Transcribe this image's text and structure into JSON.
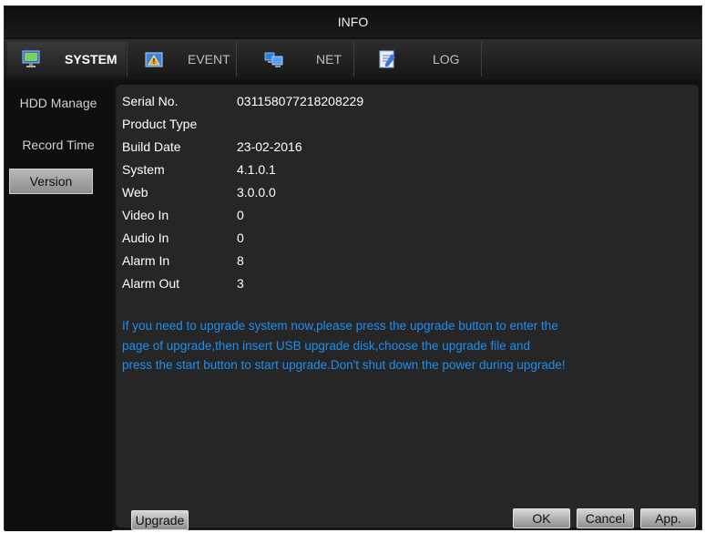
{
  "title": "INFO",
  "tabs": [
    {
      "label": "SYSTEM",
      "icon": "monitor-icon",
      "active": true
    },
    {
      "label": "EVENT",
      "icon": "warning-icon",
      "active": false
    },
    {
      "label": "NET",
      "icon": "network-icon",
      "active": false
    },
    {
      "label": "LOG",
      "icon": "notepad-icon",
      "active": false
    }
  ],
  "sidebar": {
    "items": [
      {
        "label": "HDD Manage",
        "active": false
      },
      {
        "label": "Record Time",
        "active": false
      },
      {
        "label": "Version",
        "active": true
      }
    ]
  },
  "info": [
    {
      "key": "Serial No.",
      "value": "031158077218208229"
    },
    {
      "key": "Product Type",
      "value": ""
    },
    {
      "key": "Build Date",
      "value": "23-02-2016"
    },
    {
      "key": "System",
      "value": "4.1.0.1"
    },
    {
      "key": "Web",
      "value": "3.0.0.0"
    },
    {
      "key": "Video In",
      "value": "0"
    },
    {
      "key": "Audio In",
      "value": "0"
    },
    {
      "key": "Alarm In",
      "value": "8"
    },
    {
      "key": "Alarm Out",
      "value": "3"
    }
  ],
  "notice": {
    "lines": [
      "If you need to upgrade system now,please press the upgrade button to enter the",
      "page of upgrade,then insert USB upgrade disk,choose the upgrade file and",
      "press the start button to start upgrade.Don't shut down the power during upgrade!"
    ]
  },
  "buttons": {
    "upgrade": "Upgrade",
    "ok": "OK",
    "cancel": "Cancel",
    "apply": "App."
  },
  "colors": {
    "notice_text": "#1f8ef0",
    "background": "#262626"
  }
}
